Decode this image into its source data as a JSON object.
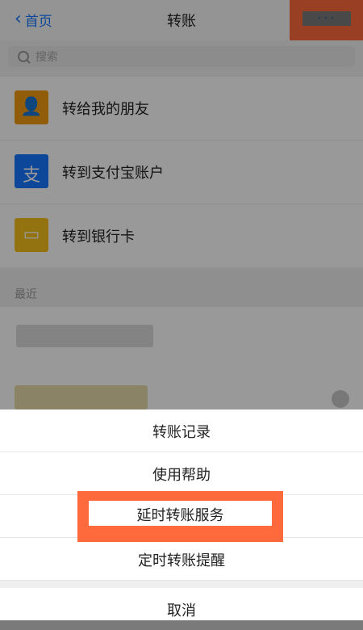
{
  "header": {
    "back_label": "首页",
    "title": "转账",
    "more_label": "···"
  },
  "search": {
    "placeholder": "搜索"
  },
  "transfer_options": [
    {
      "label": "转给我的朋友",
      "icon": "contacts-icon",
      "color": "#f39c12"
    },
    {
      "label": "转到支付宝账户",
      "icon": "alipay-icon",
      "color": "#1677ff"
    },
    {
      "label": "转到银行卡",
      "icon": "bank-card-icon",
      "color": "#f3c019"
    }
  ],
  "recent": {
    "label": "最近"
  },
  "action_sheet": {
    "options": [
      {
        "label": "转账记录"
      },
      {
        "label": "使用帮助"
      },
      {
        "label": "延时转账服务"
      },
      {
        "label": "定时转账提醒"
      }
    ],
    "cancel": "取消"
  }
}
